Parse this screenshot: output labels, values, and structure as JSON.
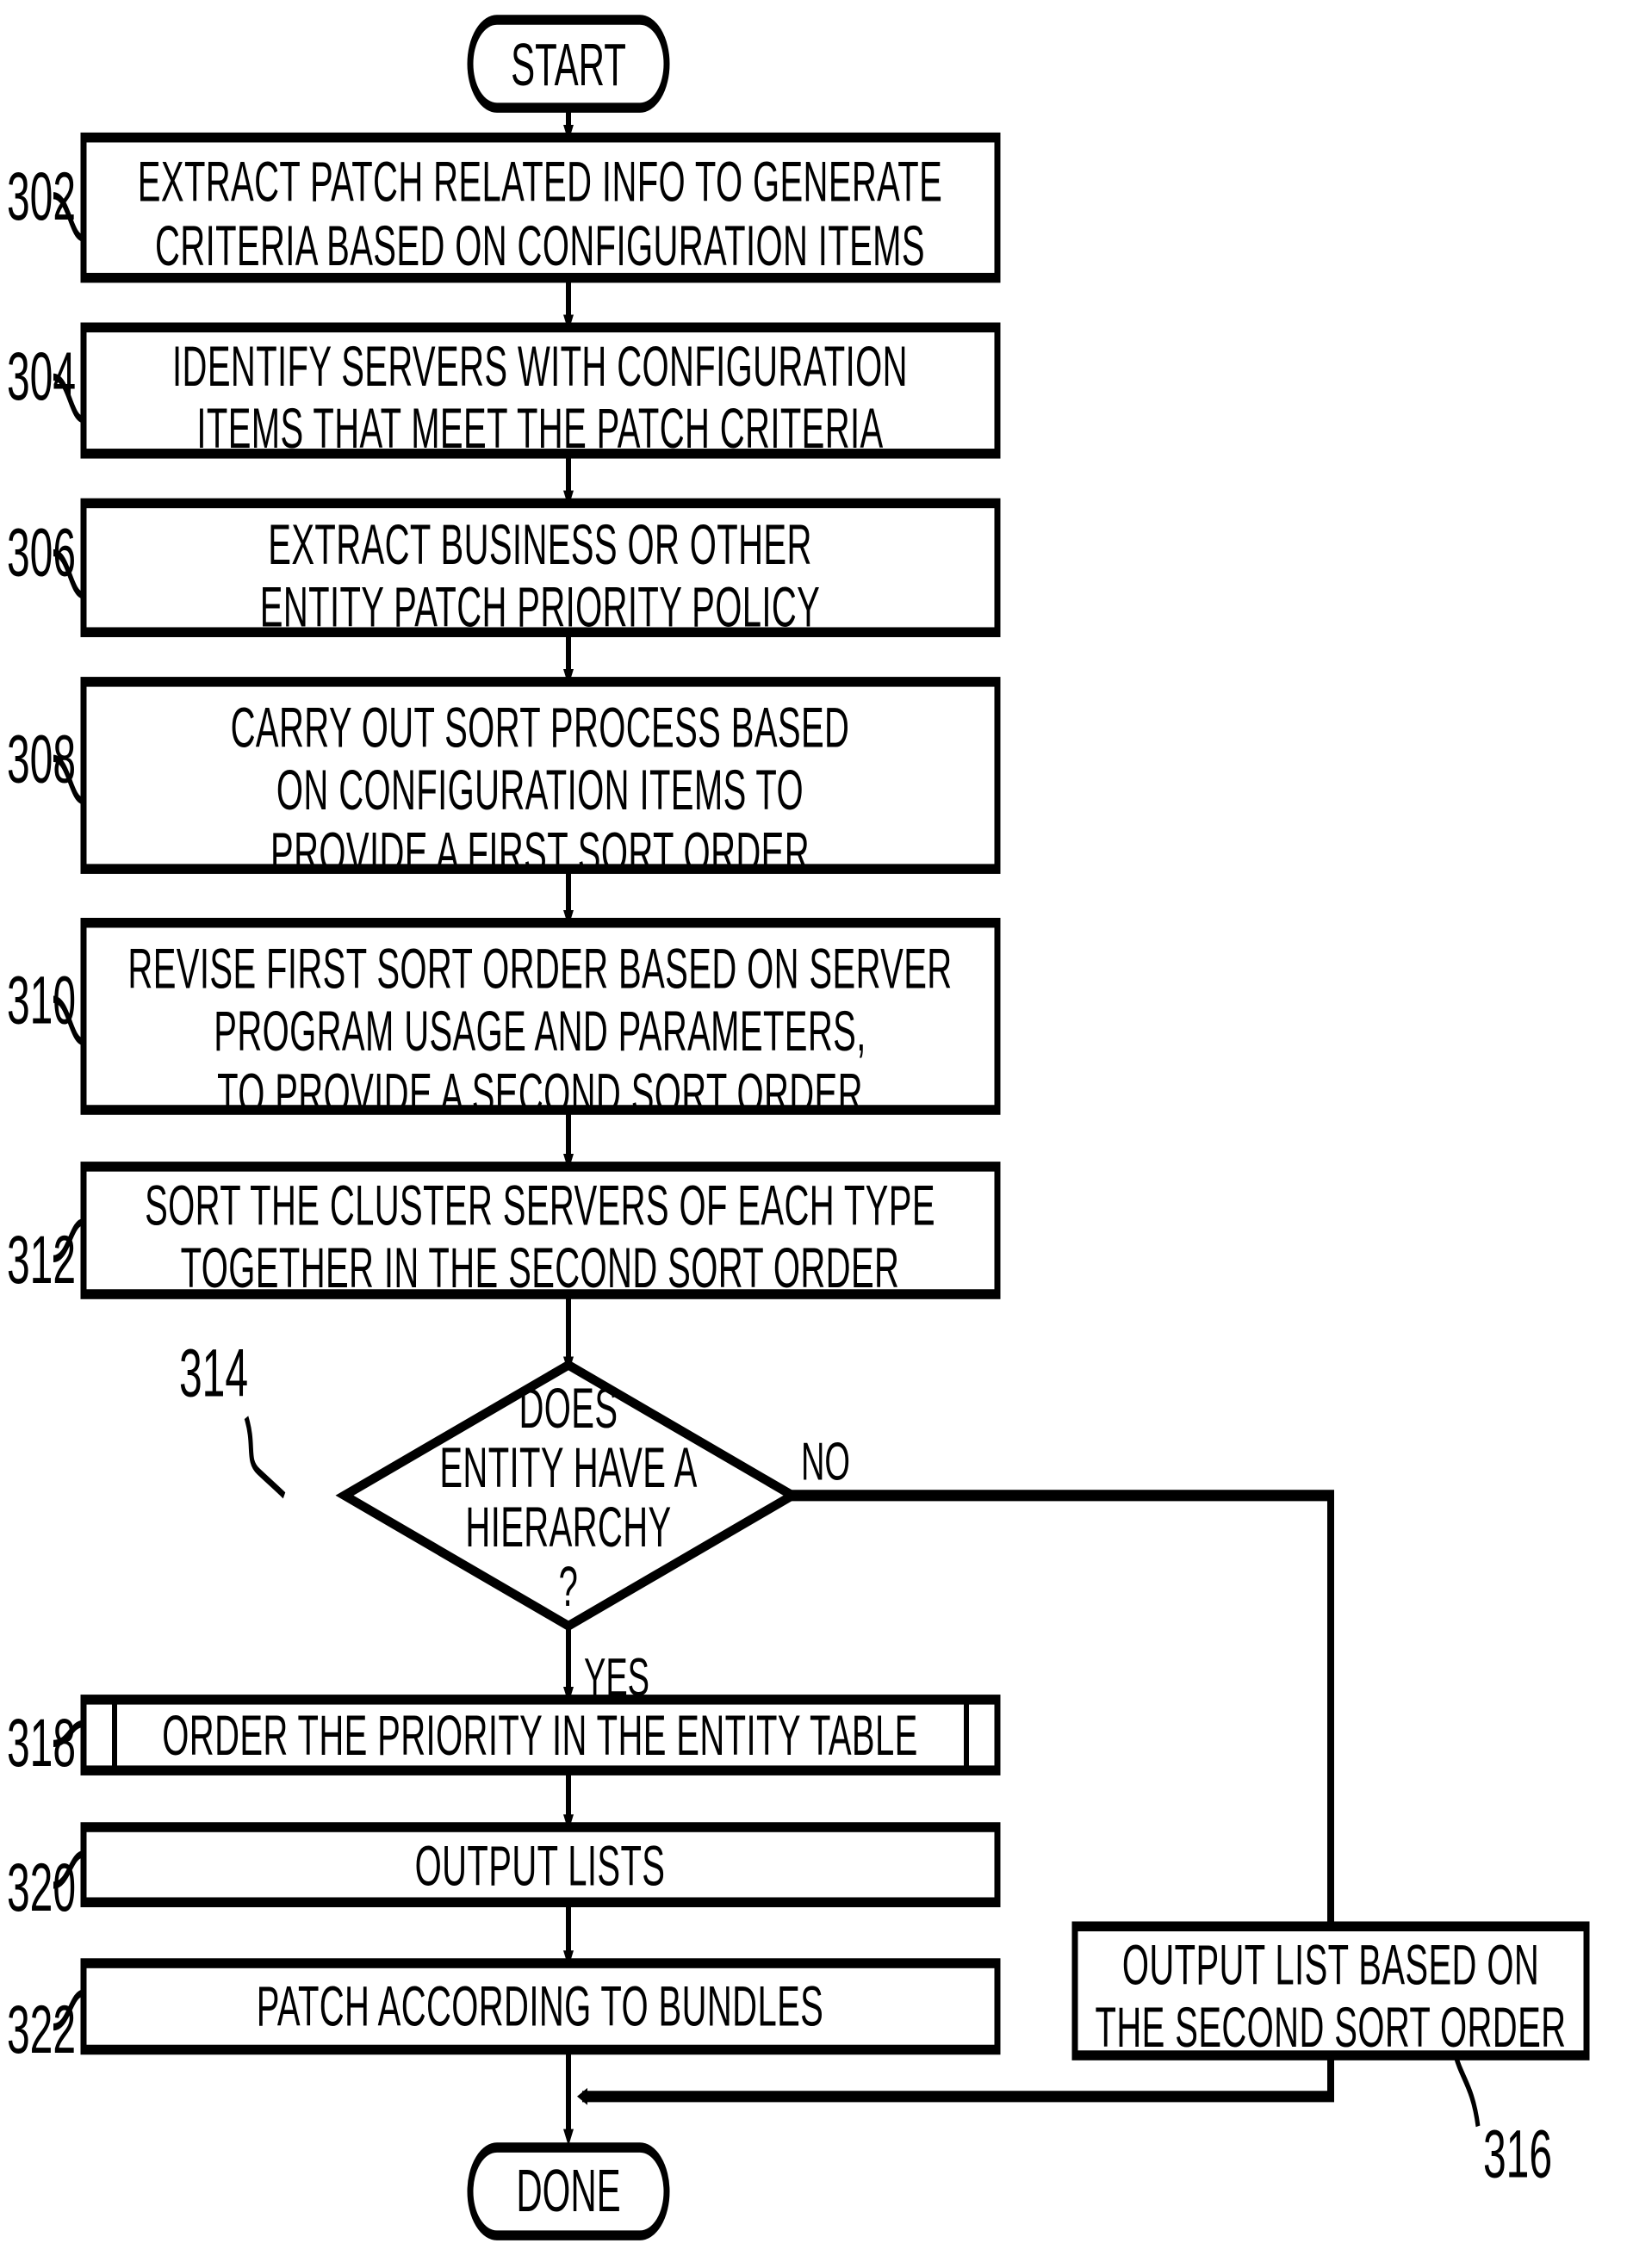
{
  "figure": {
    "type": "flowchart",
    "background": "#ffffff",
    "line_color": "#000000",
    "terminators": [
      {
        "id": "start",
        "label": "START"
      },
      {
        "id": "done",
        "label": "DONE"
      }
    ],
    "steps": [
      {
        "ref": "302",
        "shape": "process",
        "lines": [
          "EXTRACT PATCH  RELATED INFO TO GENERATE",
          "CRITERIA BASED ON CONFIGURATION ITEMS"
        ]
      },
      {
        "ref": "304",
        "shape": "process",
        "lines": [
          "IDENTIFY SERVERS WITH CONFIGURATION",
          "ITEMS THAT MEET THE PATCH CRITERIA"
        ]
      },
      {
        "ref": "306",
        "shape": "process",
        "lines": [
          "EXTRACT BUSINESS OR OTHER",
          "ENTITY PATCH PRIORITY POLICY"
        ]
      },
      {
        "ref": "308",
        "shape": "process",
        "lines": [
          "CARRY OUT SORT PROCESS BASED",
          "ON CONFIGURATION ITEMS TO",
          "PROVIDE A FIRST SORT ORDER"
        ]
      },
      {
        "ref": "310",
        "shape": "process",
        "lines": [
          "REVISE FIRST SORT ORDER BASED ON SERVER",
          "PROGRAM USAGE AND PARAMETERS,",
          "TO PROVIDE A SECOND SORT ORDER"
        ]
      },
      {
        "ref": "312",
        "shape": "process",
        "lines": [
          "SORT THE CLUSTER SERVERS OF EACH TYPE",
          "TOGETHER IN THE SECOND SORT ORDER"
        ]
      },
      {
        "ref": "314",
        "shape": "decision",
        "lines": [
          "DOES",
          "ENTITY HAVE A",
          "HIERARCHY",
          "?"
        ]
      },
      {
        "ref": "316",
        "shape": "process",
        "lines": [
          "OUTPUT LIST BASED ON",
          "THE SECOND SORT ORDER"
        ]
      },
      {
        "ref": "318",
        "shape": "predefined-process",
        "lines": [
          "ORDER THE PRIORITY IN THE ENTITY TABLE"
        ]
      },
      {
        "ref": "320",
        "shape": "process",
        "lines": [
          "OUTPUT LISTS"
        ]
      },
      {
        "ref": "322",
        "shape": "process",
        "lines": [
          "PATCH ACCORDING TO BUNDLES"
        ]
      }
    ],
    "edge_labels": {
      "decision_no": "NO",
      "decision_yes": "YES"
    }
  }
}
